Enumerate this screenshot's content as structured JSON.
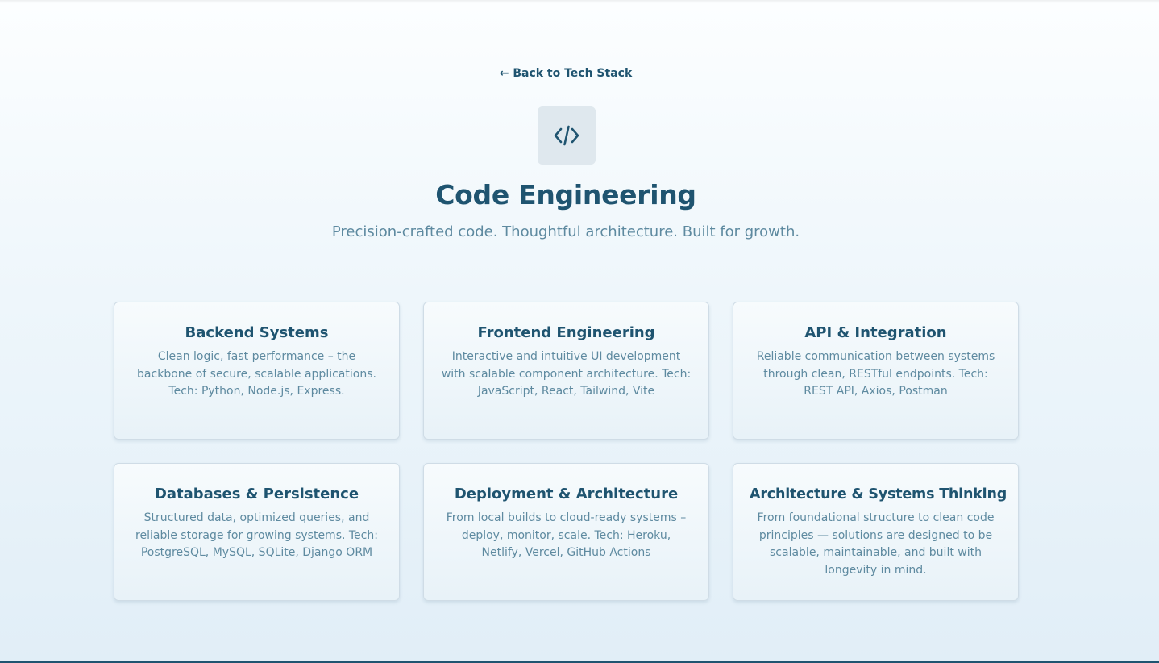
{
  "nav": {
    "back_label": "← Back to Tech Stack"
  },
  "hero": {
    "icon": "code-icon",
    "title": "Code Engineering",
    "subtitle": "Precision-crafted code. Thoughtful architecture. Built for growth."
  },
  "colors": {
    "primary": "#1f5470",
    "muted_text": "#5e8aa0",
    "icon_tile": "#dfe8ee",
    "card_border": "#cfdce6"
  },
  "cards": [
    {
      "title": "Backend Systems",
      "text": "Clean logic, fast performance – the backbone of secure, scalable applications. Tech: Python, Node.js, Express."
    },
    {
      "title": "Frontend Engineering",
      "text": "Interactive and intuitive UI development with scalable component architecture. Tech: JavaScript, React, Tailwind, Vite"
    },
    {
      "title": "API & Integration",
      "text": "Reliable communication between systems through clean, RESTful endpoints. Tech: REST API, Axios, Postman"
    },
    {
      "title": "Databases & Persistence",
      "text": "Structured data, optimized queries, and reliable storage for growing systems. Tech: PostgreSQL, MySQL, SQLite, Django ORM"
    },
    {
      "title": "Deployment & Architecture",
      "text": "From local builds to cloud-ready systems – deploy, monitor, scale. Tech: Heroku, Netlify, Vercel, GitHub Actions"
    },
    {
      "title": "Architecture & Systems Thinking",
      "text": "From foundational structure to clean code principles — solutions are designed to be scalable, maintainable, and built with longevity in mind."
    }
  ]
}
